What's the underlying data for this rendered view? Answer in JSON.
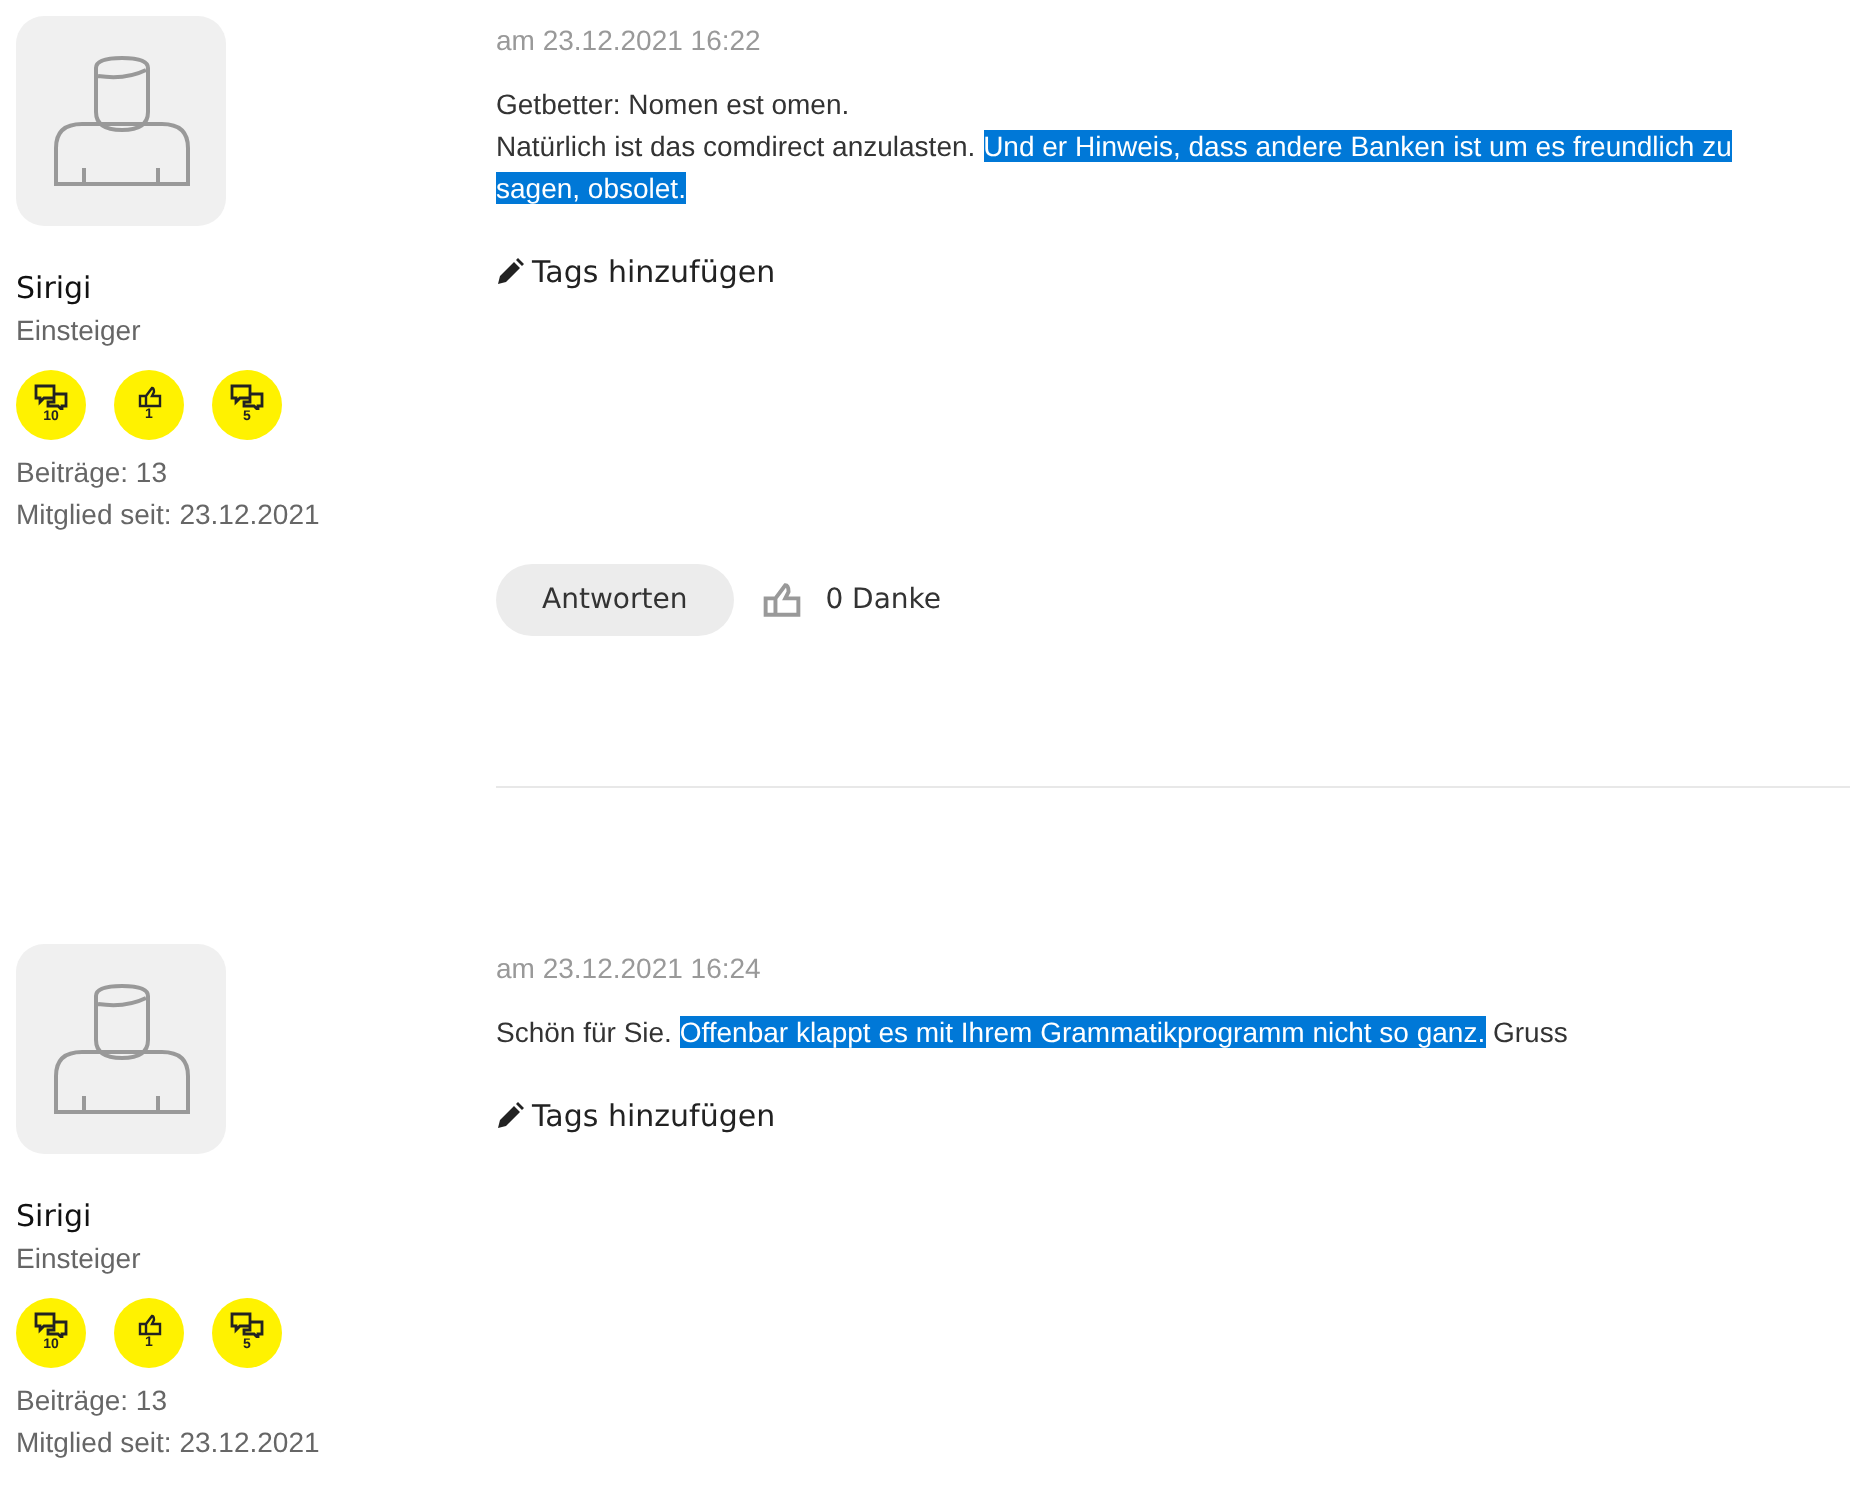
{
  "posts": [
    {
      "author": {
        "name": "Sirigi",
        "rank": "Einsteiger",
        "badges": [
          {
            "kind": "chat",
            "count": "10"
          },
          {
            "kind": "like",
            "count": "1"
          },
          {
            "kind": "chat",
            "count": "5"
          }
        ],
        "posts_count": "Beiträge: 13",
        "member_since": "Mitglied seit: 23.12.2021"
      },
      "date": "am 23.12.2021 16:22",
      "body": [
        [
          {
            "text": "Getbetter: Nomen est omen.",
            "selected": false
          }
        ],
        [
          {
            "text": "Natürlich ist das comdirect anzulasten. ",
            "selected": false
          },
          {
            "text": "Und er Hinweis, dass andere Banken ist um es freundlich zu sagen, obsolet.",
            "selected": true
          }
        ]
      ],
      "tags_link": "Tags hinzufügen",
      "actions": {
        "reply": "Antworten",
        "thanks": "0 Danke"
      }
    },
    {
      "author": {
        "name": "Sirigi",
        "rank": "Einsteiger",
        "badges": [
          {
            "kind": "chat",
            "count": "10"
          },
          {
            "kind": "like",
            "count": "1"
          },
          {
            "kind": "chat",
            "count": "5"
          }
        ],
        "posts_count": "Beiträge: 13",
        "member_since": "Mitglied seit: 23.12.2021"
      },
      "date": "am 23.12.2021 16:24",
      "body": [
        [
          {
            "text": "Schön für Sie. ",
            "selected": false
          },
          {
            "text": "Offenbar klappt es mit Ihrem Grammatikprogramm nicht so ganz.",
            "selected": true
          },
          {
            "text": " Gruss",
            "selected": false
          }
        ]
      ],
      "tags_link": "Tags hinzufügen"
    }
  ]
}
